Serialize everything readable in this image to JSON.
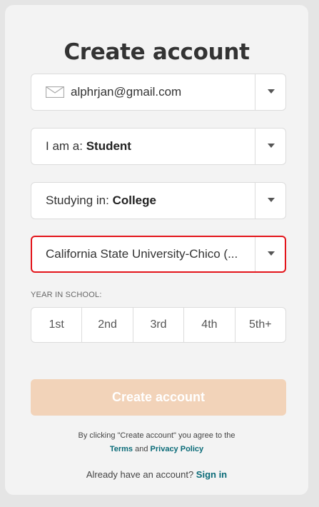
{
  "title": "Create account",
  "email": {
    "value": "alphrjan@gmail.com",
    "icon": "mail-icon"
  },
  "role": {
    "prefix": "I am a:",
    "value": "Student"
  },
  "studying": {
    "prefix": "Studying in:",
    "value": "College"
  },
  "school": {
    "value": "California State University-Chico (..."
  },
  "year": {
    "label": "YEAR IN SCHOOL:",
    "options": [
      "1st",
      "2nd",
      "3rd",
      "4th",
      "5th+"
    ]
  },
  "submit_label": "Create account",
  "terms": {
    "text": "By clicking \"Create account\" you agree to the",
    "terms_link": "Terms",
    "and": "and",
    "privacy_link": "Privacy Policy"
  },
  "signin": {
    "text": "Already have an account?",
    "link": "Sign in"
  },
  "colors": {
    "highlight_border": "#e3141a",
    "button_disabled": "#f2d3b9",
    "link": "#0a6b78"
  }
}
